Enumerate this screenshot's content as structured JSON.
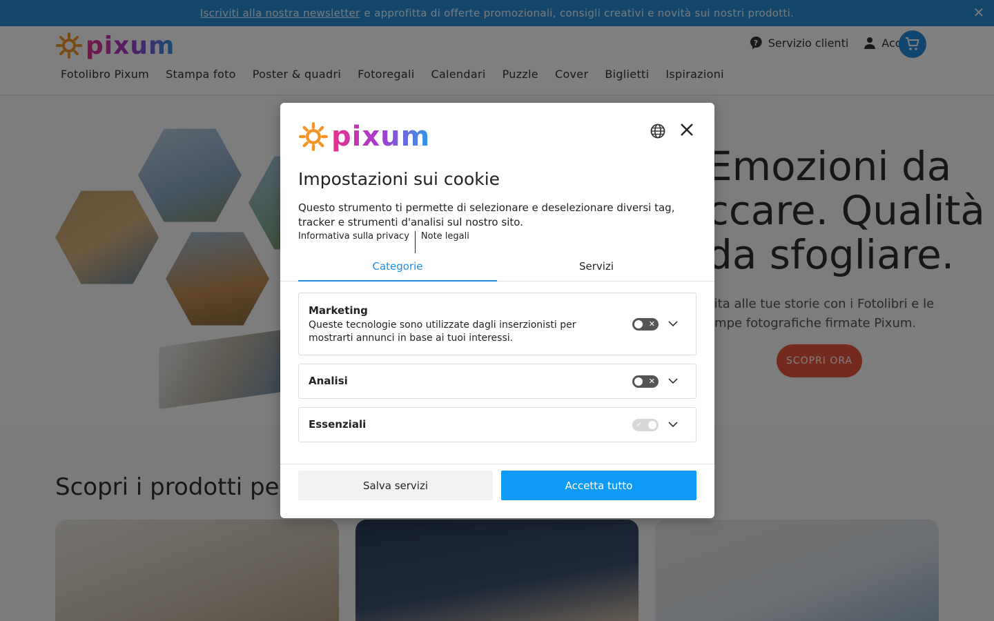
{
  "banner": {
    "link_text": "Iscriviti alla nostra newsletter",
    "text": "e approfitta di offerte promozionali, consigli creativi e novità sui nostri prodotti."
  },
  "header": {
    "logo_text": "pixum",
    "customer_service": "Servizio clienti",
    "login": "Accedi",
    "nav": [
      "Fotolibro Pixum",
      "Stampa foto",
      "Poster & quadri",
      "Fotoregali",
      "Calendari",
      "Puzzle",
      "Cover",
      "Biglietti",
      "Ispirazioni"
    ]
  },
  "hero": {
    "title_lines": [
      "Emozioni da",
      "ccare. Qualità",
      "da sfogliare."
    ],
    "subtitle_lines": [
      "vita alle tue storie con i Fotolibri e le",
      "ampe fotografiche firmate Pixum."
    ],
    "cta": "SCOPRI ORA"
  },
  "section": {
    "title": "Scopri i prodotti pe"
  },
  "modal": {
    "logo_text": "pixum",
    "title": "Impostazioni sui cookie",
    "description": "Questo strumento ti permette di selezionare e deselezionare diversi tag, tracker e strumenti d'analisi sul nostro sito.",
    "links": [
      "Informativa sulla privacy",
      "Note legali"
    ],
    "tabs": [
      "Categorie",
      "Servizi"
    ],
    "categories": [
      {
        "title": "Marketing",
        "description": "Queste tecnologie sono utilizzate dagli inserzionisti per mostrarti annunci in base ai tuoi interessi.",
        "enabled": false
      },
      {
        "title": "Analisi",
        "description": "",
        "enabled": false
      },
      {
        "title": "Essenziali",
        "description": "",
        "enabled": true
      }
    ],
    "save_button": "Salva servizi",
    "accept_button": "Accetta tutto"
  },
  "colors": {
    "accent_blue": "#0f9af5",
    "banner_blue": "#2b8fd6",
    "cta_orange": "#e8553a"
  }
}
